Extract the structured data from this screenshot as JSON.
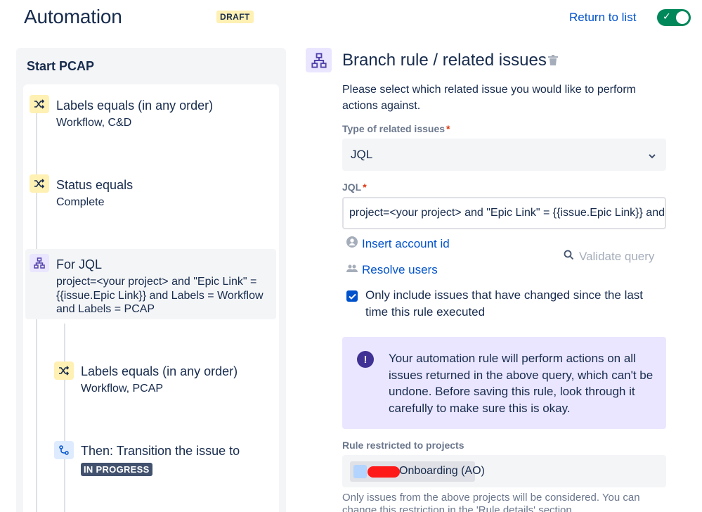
{
  "header": {
    "title": "Automation",
    "draft_badge": "DRAFT",
    "return_link": "Return to list",
    "toggle_enabled": true
  },
  "rule": {
    "name": "Start PCAP",
    "steps": [
      {
        "type": "condition",
        "icon": "shuffle-icon",
        "title": "Labels equals (in any order)",
        "subtitle": "Workflow, C&D"
      },
      {
        "type": "condition",
        "icon": "shuffle-icon",
        "title": "Status equals",
        "subtitle": "Complete"
      },
      {
        "type": "branch",
        "icon": "branch-icon",
        "title": "For JQL",
        "subtitle": "project=<your project> and \"Epic Link\" = {{issue.Epic Link}} and Labels = Workflow and Labels = PCAP",
        "selected": true
      },
      {
        "type": "condition",
        "icon": "shuffle-icon",
        "title": "Labels equals (in any order)",
        "subtitle": "Workflow, PCAP"
      },
      {
        "type": "action",
        "icon": "transition-icon",
        "title": "Then: Transition the issue to",
        "status": "IN PROGRESS"
      }
    ]
  },
  "detail": {
    "title": "Branch rule / related issues",
    "description": "Please select which related issue you would like to perform actions against.",
    "type_label": "Type of related issues",
    "type_required": "*",
    "type_value": "JQL",
    "jql_label": "JQL",
    "jql_required": "*",
    "jql_value": "project=<your project> and \"Epic Link\" = {{issue.Epic Link}} and Labels = Workflow and Labels = PCAP",
    "insert_account_id": "Insert account id",
    "resolve_users": "Resolve users",
    "validate_query": "Validate query",
    "only_changed_checked": true,
    "only_changed_label": "Only include issues that have changed since the last time this rule executed",
    "info_text": "Your automation rule will perform actions on all issues returned in the above query, which can't be undone. Before saving this rule, look through it carefully to make sure this is okay.",
    "restricted_label": "Rule restricted to projects",
    "project_name": "Onboarding (AO)",
    "footnote": "Only issues from the above projects will be considered. You can change this restriction in the 'Rule details' section."
  },
  "colors": {
    "accent": "#0052cc",
    "toggle_on": "#00875a",
    "condition_bg": "#fff0b3",
    "branch_bg": "#eae6ff",
    "action_bg": "#deebff",
    "status_lozenge": "#42526e"
  }
}
